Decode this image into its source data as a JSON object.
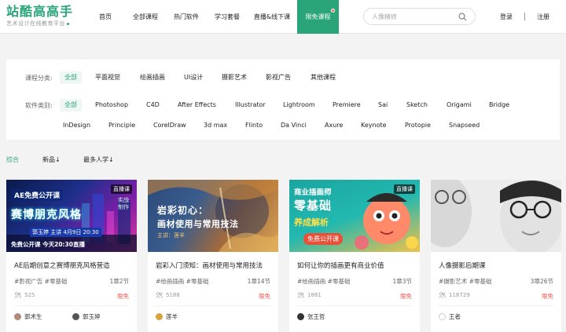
{
  "logo": {
    "name": "站酷高高手",
    "slogan": "艺术设计在线教育平台"
  },
  "nav": [
    {
      "label": "首页"
    },
    {
      "label": "全部课程"
    },
    {
      "label": "热门软件"
    },
    {
      "label": "学习套餐"
    },
    {
      "label": "直播&线下课"
    },
    {
      "label": "限免课程",
      "active": true
    }
  ],
  "search": {
    "placeholder": "人像精修",
    "value": ""
  },
  "auth": {
    "login": "登录",
    "register": "注册"
  },
  "filter": {
    "category_label": "课程分类:",
    "categories": [
      "全部",
      "平面视觉",
      "绘画插画",
      "UI设计",
      "摄影艺术",
      "影视广告",
      "其他课程"
    ],
    "software_label": "软件类别:",
    "software": [
      "全部",
      "Photoshop",
      "C4D",
      "After Effects",
      "Illustrator",
      "Lightroom",
      "Premiere",
      "Sai",
      "Sketch",
      "Origami",
      "Bridge",
      "InDesign",
      "Principle",
      "CorelDraw",
      "3d max",
      "Flinto",
      "Da Vinci",
      "Axure",
      "Keynote",
      "Protopie",
      "Snapseed"
    ]
  },
  "sort": [
    "综合",
    "新品↓",
    "最多人学↓"
  ],
  "cards": [
    {
      "title": "AE后期创意之赛博朋克风格营造",
      "tags": "#影视广告 #零基础",
      "chapters": "1章2节",
      "views": "525",
      "price": "限免",
      "teachers": [
        "郭术生",
        "郭玉婷"
      ],
      "badge": "直播课",
      "thumb_text": [
        "AE免费公开课",
        "赛博朋克风格",
        "郭玉婷 主讲 4月9日 20:30",
        "免费公开课 今天20:30直播",
        "实战\n制作"
      ]
    },
    {
      "title": "岩彩入门须知：画材使用与常用技法",
      "tags": "#绘画插画 #零基础",
      "chapters": "1章14节",
      "views": "5188",
      "price": "限免",
      "teachers": [
        "莲羊"
      ],
      "thumb_text": [
        "岩彩初心：",
        "画材使用与常用技法",
        "主讲：莲羊"
      ]
    },
    {
      "title": "如何让你的插画更有商业价值",
      "tags": "#绘画插画 #零基础",
      "chapters": "1章3节",
      "views": "1881",
      "price": "限免",
      "teachers": [
        "张王哲"
      ],
      "badge": "直播课",
      "thumb_text": [
        "商业插画师",
        "零基础",
        "养成解析",
        "免费公开课"
      ]
    },
    {
      "title": "人像摄影后期课",
      "tags": "#摄影艺术 #零基础",
      "chapters": "3章26节",
      "views": "118729",
      "price": "限免",
      "teachers": [
        "王者"
      ]
    }
  ],
  "colors": {
    "brand": "#2aa57a",
    "free": "#f0534f"
  }
}
